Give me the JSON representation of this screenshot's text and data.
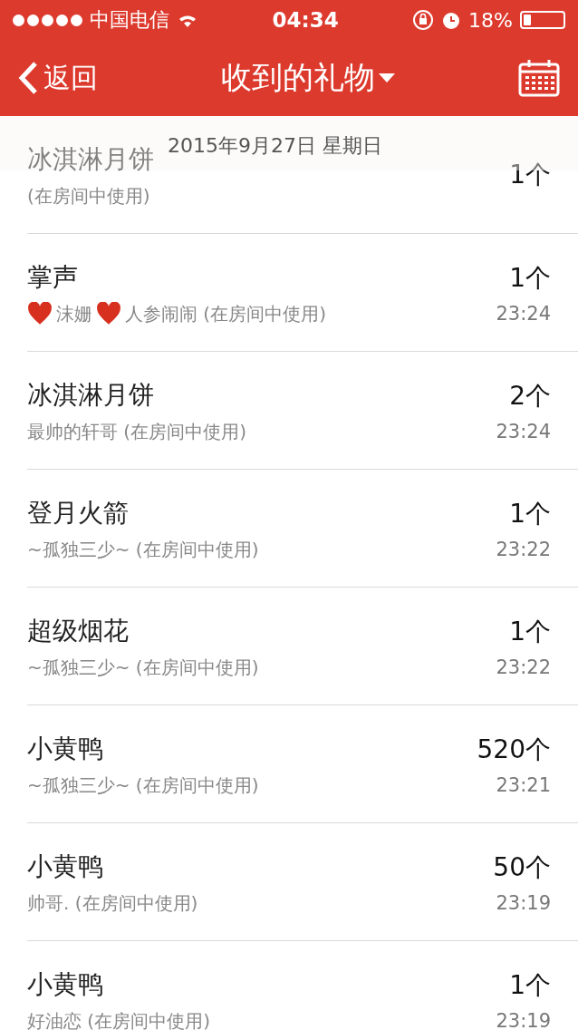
{
  "status_bar": {
    "carrier": "中国电信",
    "time": "04:34",
    "battery_text": "18%",
    "battery": {
      "level": 0.18
    }
  },
  "nav_bar": {
    "back": "返回",
    "title": "收到的礼物"
  },
  "date_header": "2015年9月27日 星期日",
  "gifts": [
    {
      "name": "冰淇淋月饼",
      "count": "1个",
      "sender": [
        {
          "kind": "text",
          "text": "(在房间中使用)"
        }
      ]
    },
    {
      "name": "掌声",
      "count": "1个",
      "sender": [
        {
          "kind": "heart"
        },
        {
          "kind": "text",
          "text": "沫姗"
        },
        {
          "kind": "heart"
        },
        {
          "kind": "text",
          "text": "人参闹闹 (在房间中使用)"
        }
      ],
      "time": "23:24"
    },
    {
      "name": "冰淇淋月饼",
      "count": "2个",
      "sender": [
        {
          "kind": "text",
          "text": "最帅的轩哥 (在房间中使用)"
        }
      ],
      "time": "23:24"
    },
    {
      "name": "登月火箭",
      "count": "1个",
      "sender": [
        {
          "kind": "text",
          "text": "~孤独三少~ (在房间中使用)"
        }
      ],
      "time": "23:22"
    },
    {
      "name": "超级烟花",
      "count": "1个",
      "sender": [
        {
          "kind": "text",
          "text": "~孤独三少~ (在房间中使用)"
        }
      ],
      "time": "23:22"
    },
    {
      "name": "小黄鸭",
      "count": "520个",
      "sender": [
        {
          "kind": "text",
          "text": "~孤独三少~ (在房间中使用)"
        }
      ],
      "time": "23:21"
    },
    {
      "name": "小黄鸭",
      "count": "50个",
      "sender": [
        {
          "kind": "text",
          "text": "帅哥. (在房间中使用)"
        }
      ],
      "time": "23:19"
    },
    {
      "name": "小黄鸭",
      "count": "1个",
      "sender": [
        {
          "kind": "text",
          "text": "好油恋 (在房间中使用)"
        }
      ],
      "time": "23:19"
    }
  ]
}
